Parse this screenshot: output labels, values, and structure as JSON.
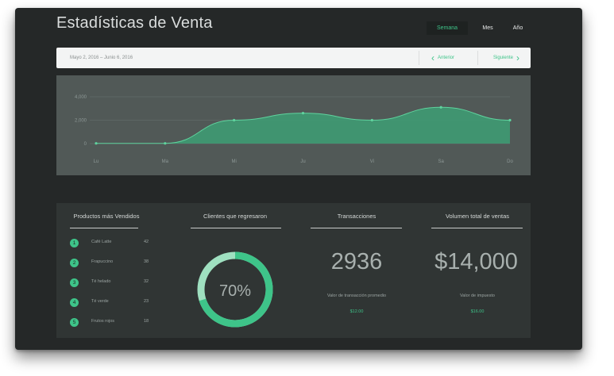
{
  "header": {
    "title": "Estadísticas de Venta",
    "periods": [
      "Semana",
      "Mes",
      "Año"
    ],
    "active_period": "Semana"
  },
  "datebar": {
    "range": "Mayo 2, 2016  –  Junio 6, 2016",
    "prev_label": "Anterior",
    "next_label": "Siguiente"
  },
  "colors": {
    "accent": "#3ec489",
    "background": "#252828",
    "panel": "#303534",
    "chart_panel": "#515957"
  },
  "chart_data": {
    "type": "area",
    "categories": [
      "Lu",
      "Ma",
      "Mi",
      "Ju",
      "Vi",
      "Sa",
      "Do"
    ],
    "values": [
      20,
      20,
      2000,
      2600,
      2000,
      3100,
      2000
    ],
    "y_ticks": [
      "0",
      "2,000",
      "4,000"
    ],
    "ylim": [
      0,
      4000
    ],
    "grid": true
  },
  "stats": {
    "products": {
      "title": "Productos más Vendidos",
      "items": [
        {
          "rank": "1",
          "name": "Café Latte",
          "count": "42"
        },
        {
          "rank": "2",
          "name": "Frapuccino",
          "count": "38"
        },
        {
          "rank": "3",
          "name": "Té helado",
          "count": "32"
        },
        {
          "rank": "4",
          "name": "Té verde",
          "count": "23"
        },
        {
          "rank": "5",
          "name": "Frutos rojos",
          "count": "18"
        }
      ]
    },
    "returning": {
      "title": "Clientes que regresaron",
      "percent_label": "70%",
      "percent": 70
    },
    "transactions": {
      "title": "Transacciones",
      "value": "2936",
      "sub_label": "Valor de transacción promedio",
      "sub_value": "$12.00"
    },
    "volume": {
      "title": "Volumen total de ventas",
      "value": "$14,000",
      "sub_label": "Valor de impuesto",
      "sub_value": "$16.00"
    }
  }
}
